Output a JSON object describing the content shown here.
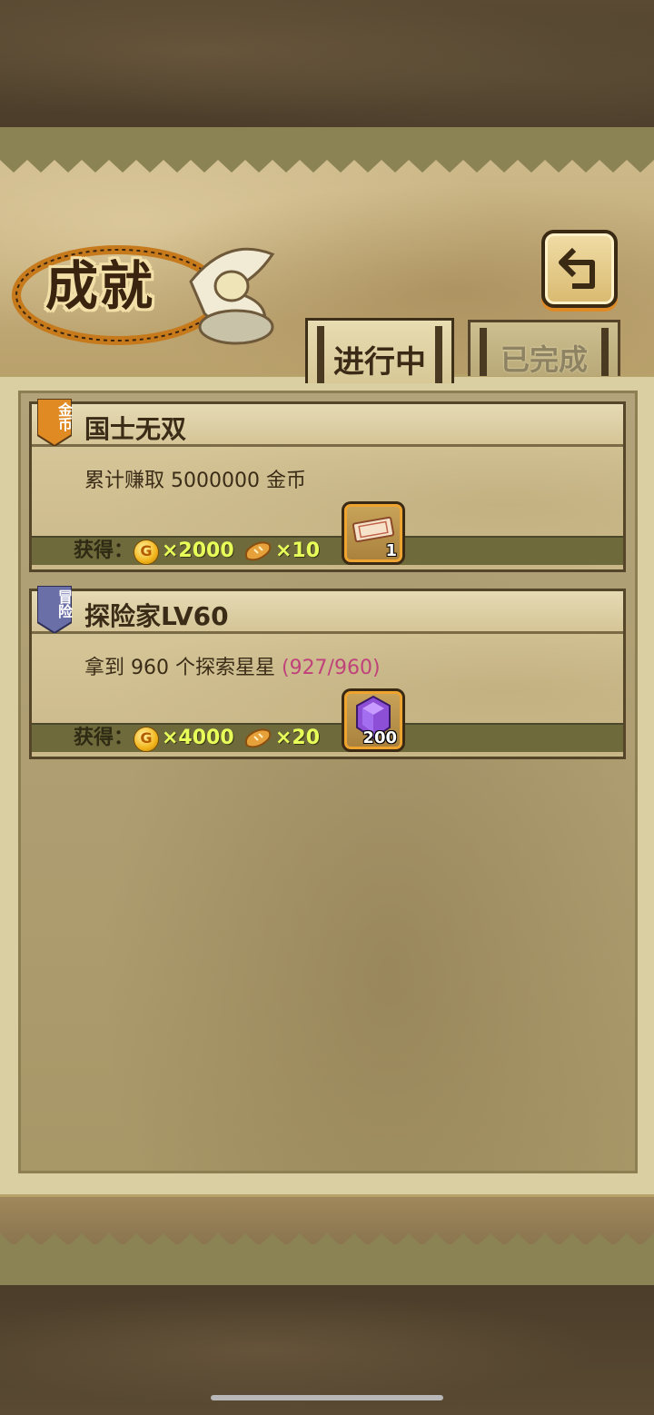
{
  "header": {
    "title": "成就",
    "back_icon": "return-arrow-icon"
  },
  "tabs": [
    {
      "label": "进行中",
      "active": true
    },
    {
      "label": "已完成",
      "active": false
    }
  ],
  "achievements": [
    {
      "category": "金币",
      "category_color": "#e08a24",
      "title": "国士无双",
      "description": "累计赚取 5000000 金币",
      "progress": "",
      "reward_label": "获得：",
      "coin_symbol": "G",
      "coin_amount": "×2000",
      "bread_amount": "×10",
      "item_icon": "ticket-icon",
      "item_count": "1"
    },
    {
      "category": "冒险",
      "category_color": "#6b6fa8",
      "title": "探险家LV60",
      "description": "拿到 960 个探索星星 ",
      "progress": "(927/960)",
      "reward_label": "获得：",
      "coin_symbol": "G",
      "coin_amount": "×4000",
      "bread_amount": "×20",
      "item_icon": "purple-gem-icon",
      "item_count": "200"
    }
  ]
}
